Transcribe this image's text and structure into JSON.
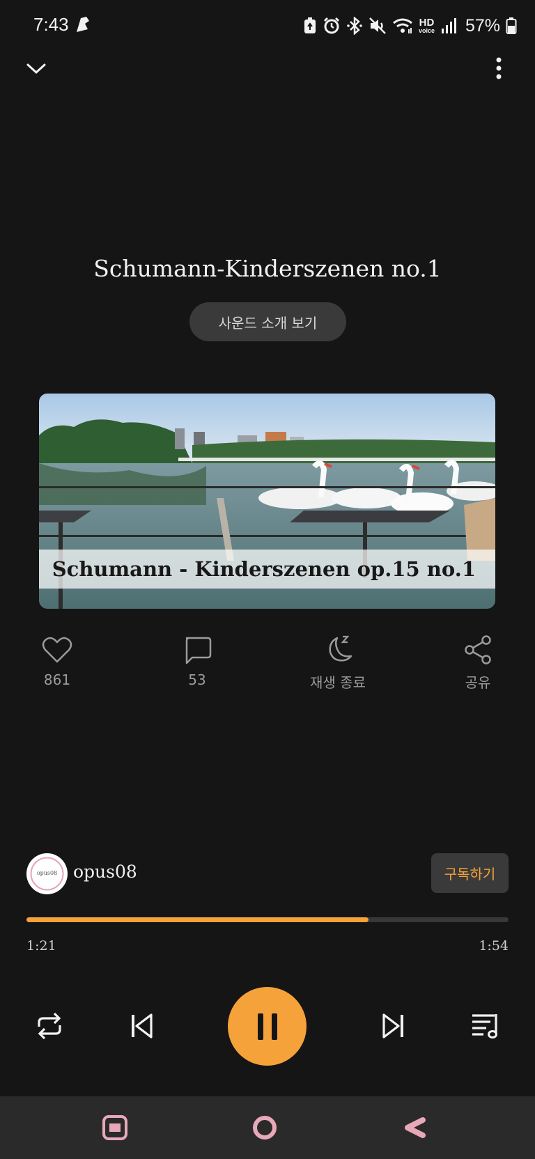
{
  "status_bar": {
    "time": "7:43",
    "battery_percent": "57%",
    "hd_label": "HD",
    "voice_label": "voice",
    "icons": [
      "battery-saver-icon",
      "alarm-icon",
      "bluetooth-icon",
      "mute-icon",
      "wifi-icon",
      "hd-voice-icon",
      "signal-icon",
      "battery-icon"
    ]
  },
  "header": {
    "collapse_icon": "chevron-down-icon",
    "more_icon": "more-vertical-icon"
  },
  "track": {
    "title": "Schumann-Kinderszenen no.1",
    "intro_button_label": "사운드 소개 보기",
    "artwork_caption": "Schumann - Kinderszenen op.15 no.1"
  },
  "actions": {
    "like": {
      "icon": "heart-icon",
      "label": "861"
    },
    "comment": {
      "icon": "comment-icon",
      "label": "53"
    },
    "sleep_timer": {
      "icon": "moon-icon",
      "label": "재생 종료"
    },
    "share": {
      "icon": "share-icon",
      "label": "공유"
    }
  },
  "channel": {
    "name": "opus08",
    "avatar_text": "opus08",
    "subscribe_label": "구독하기"
  },
  "playback": {
    "elapsed": "1:21",
    "total": "1:54",
    "progress_fraction": 0.71
  },
  "controls": {
    "repeat_icon": "repeat-icon",
    "previous_icon": "skip-previous-icon",
    "play_pause_icon": "pause-icon",
    "next_icon": "skip-next-icon",
    "queue_icon": "playlist-icon"
  },
  "colors": {
    "accent": "#f6a23a",
    "background": "#151515",
    "surface": "#3a3a3a",
    "nav_bar": "#2a2a2a",
    "nav_icon": "#e8a8ba"
  },
  "nav_bar": {
    "recents_icon": "recents-icon",
    "home_icon": "home-icon",
    "back_icon": "back-icon"
  }
}
